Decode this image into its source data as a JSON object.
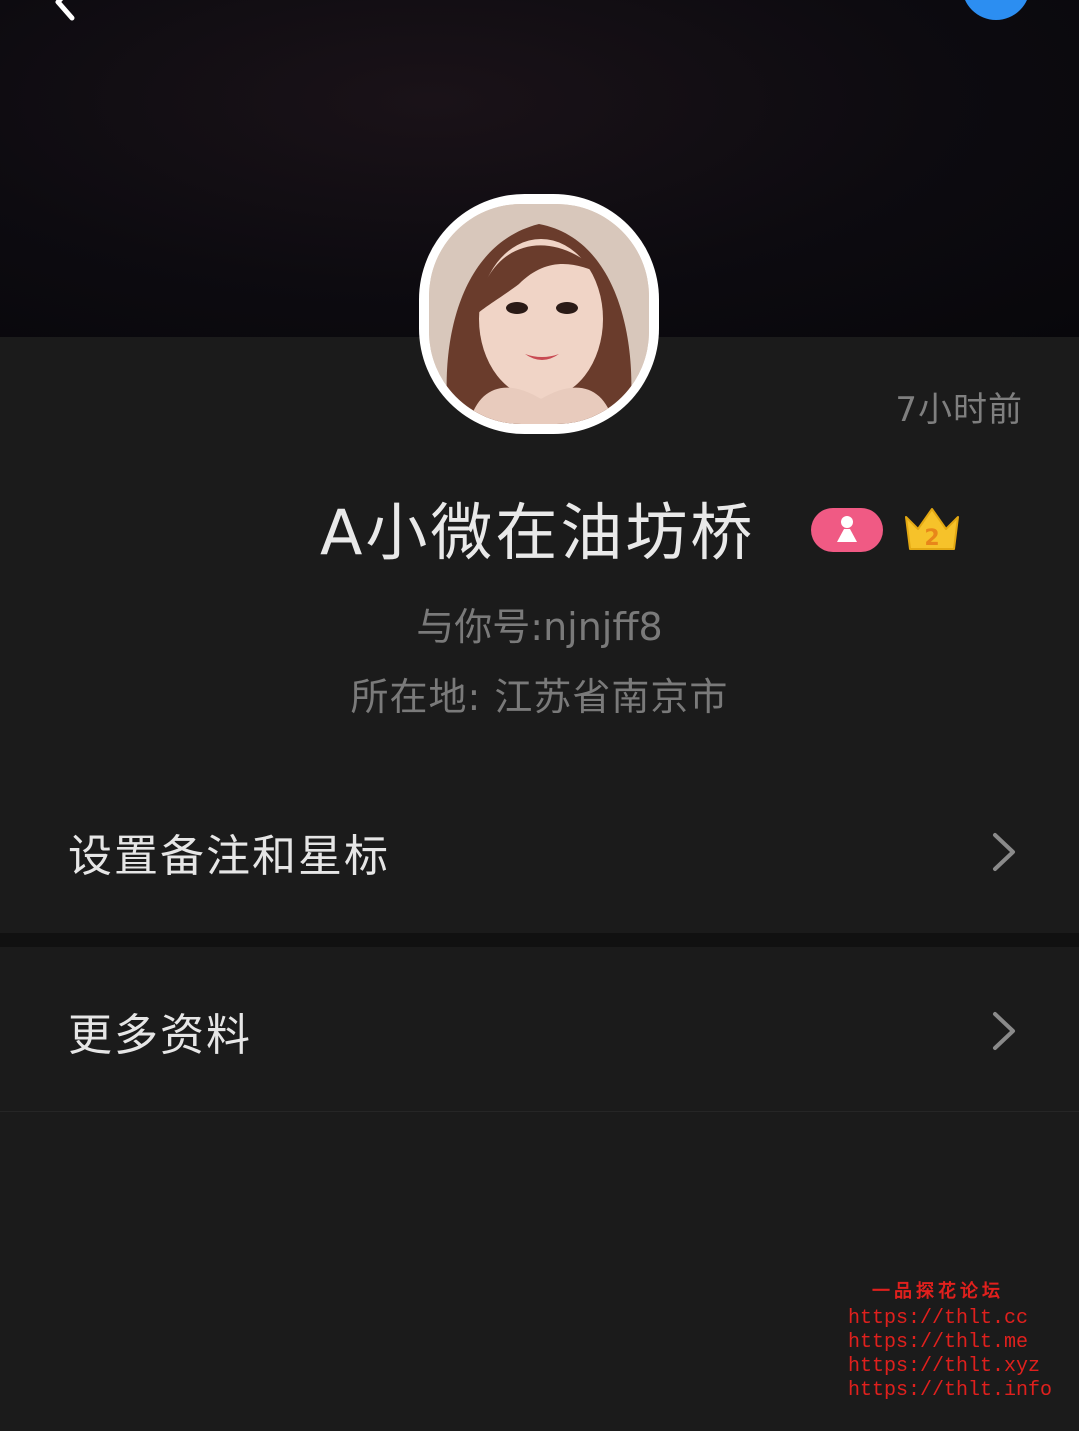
{
  "header": {
    "back_icon": "chevron-left-icon",
    "corner_button_color": "#2c8ef1"
  },
  "profile": {
    "avatar": "profile-photo",
    "last_active": "7小时前",
    "name": "A小微在油坊桥",
    "gender_badge_color": "#f05a84",
    "vip_level": "2",
    "account_id": "与你号:njnjff8",
    "location": "所在地: 江苏省南京市"
  },
  "menu": {
    "items": [
      {
        "label": "设置备注和星标"
      },
      {
        "label": "更多资料"
      }
    ]
  },
  "watermark": {
    "title": "一品探花论坛",
    "urls": [
      "https://thlt.cc",
      "https://thlt.me",
      "https://thlt.xyz",
      "https://thlt.info"
    ]
  }
}
